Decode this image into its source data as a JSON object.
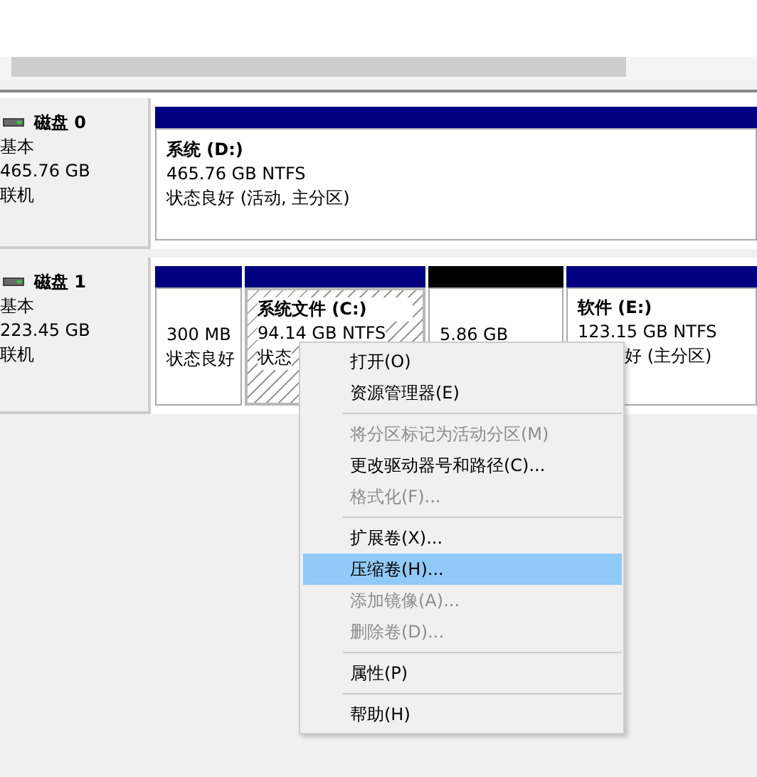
{
  "disks": [
    {
      "name": "磁盘 0",
      "type": "基本",
      "size": "465.76 GB",
      "status": "联机",
      "partitions": [
        {
          "color": "#000080",
          "selected": false,
          "title": "系统  (D:)",
          "lines": [
            "465.76 GB NTFS",
            "状态良好 (活动, 主分区)"
          ]
        }
      ]
    },
    {
      "name": "磁盘 1",
      "type": "基本",
      "size": "223.45 GB",
      "status": "联机",
      "partitions": [
        {
          "color": "#000080",
          "selected": false,
          "lines": [
            "300 MB",
            "状态良好"
          ]
        },
        {
          "color": "#000080",
          "selected": true,
          "title": "系统文件  (C:)",
          "lines": [
            "94.14 GB NTFS",
            "状态"
          ]
        },
        {
          "color": "#000000",
          "selected": false,
          "lines": [
            "5.86 GB"
          ]
        },
        {
          "color": "#000080",
          "selected": false,
          "title": "软件  (E:)",
          "lines": [
            "123.15 GB NTFS",
            "好 (主分区)"
          ]
        }
      ]
    }
  ],
  "context_menu": [
    {
      "kind": "item",
      "label": "打开(O)",
      "disabled": false,
      "selected": false
    },
    {
      "kind": "item",
      "label": "资源管理器(E)",
      "disabled": false,
      "selected": false
    },
    {
      "kind": "separator"
    },
    {
      "kind": "item",
      "label": "将分区标记为活动分区(M)",
      "disabled": true,
      "selected": false
    },
    {
      "kind": "item",
      "label": "更改驱动器号和路径(C)...",
      "disabled": false,
      "selected": false
    },
    {
      "kind": "item",
      "label": "格式化(F)...",
      "disabled": true,
      "selected": false
    },
    {
      "kind": "separator"
    },
    {
      "kind": "item",
      "label": "扩展卷(X)...",
      "disabled": false,
      "selected": false
    },
    {
      "kind": "item",
      "label": "压缩卷(H)...",
      "disabled": false,
      "selected": true
    },
    {
      "kind": "item",
      "label": "添加镜像(A)...",
      "disabled": true,
      "selected": false
    },
    {
      "kind": "item",
      "label": "删除卷(D)...",
      "disabled": true,
      "selected": false
    },
    {
      "kind": "separator"
    },
    {
      "kind": "item",
      "label": "属性(P)",
      "disabled": false,
      "selected": false
    },
    {
      "kind": "separator"
    },
    {
      "kind": "item",
      "label": "帮助(H)",
      "disabled": false,
      "selected": false
    }
  ]
}
